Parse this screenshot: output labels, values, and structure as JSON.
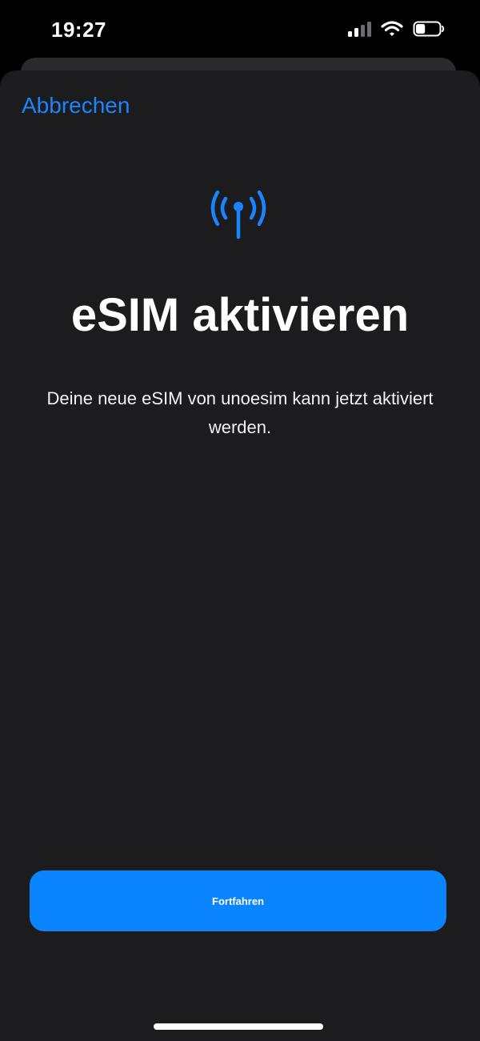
{
  "status_bar": {
    "time": "19:27",
    "signal_bars_active": 2,
    "signal_bars_total": 4,
    "battery_level": 0.4
  },
  "sheet": {
    "cancel_label": "Abbrechen",
    "icon": "antenna-icon",
    "title": "eSIM aktivieren",
    "description": "Deine neue eSIM von unoesim kann jetzt aktiviert werden.",
    "continue_label": "Fortfahren"
  },
  "colors": {
    "accent": "#0a84ff",
    "link": "#1a84ff",
    "sheet_background": "#1c1c1e",
    "background": "#000000"
  }
}
